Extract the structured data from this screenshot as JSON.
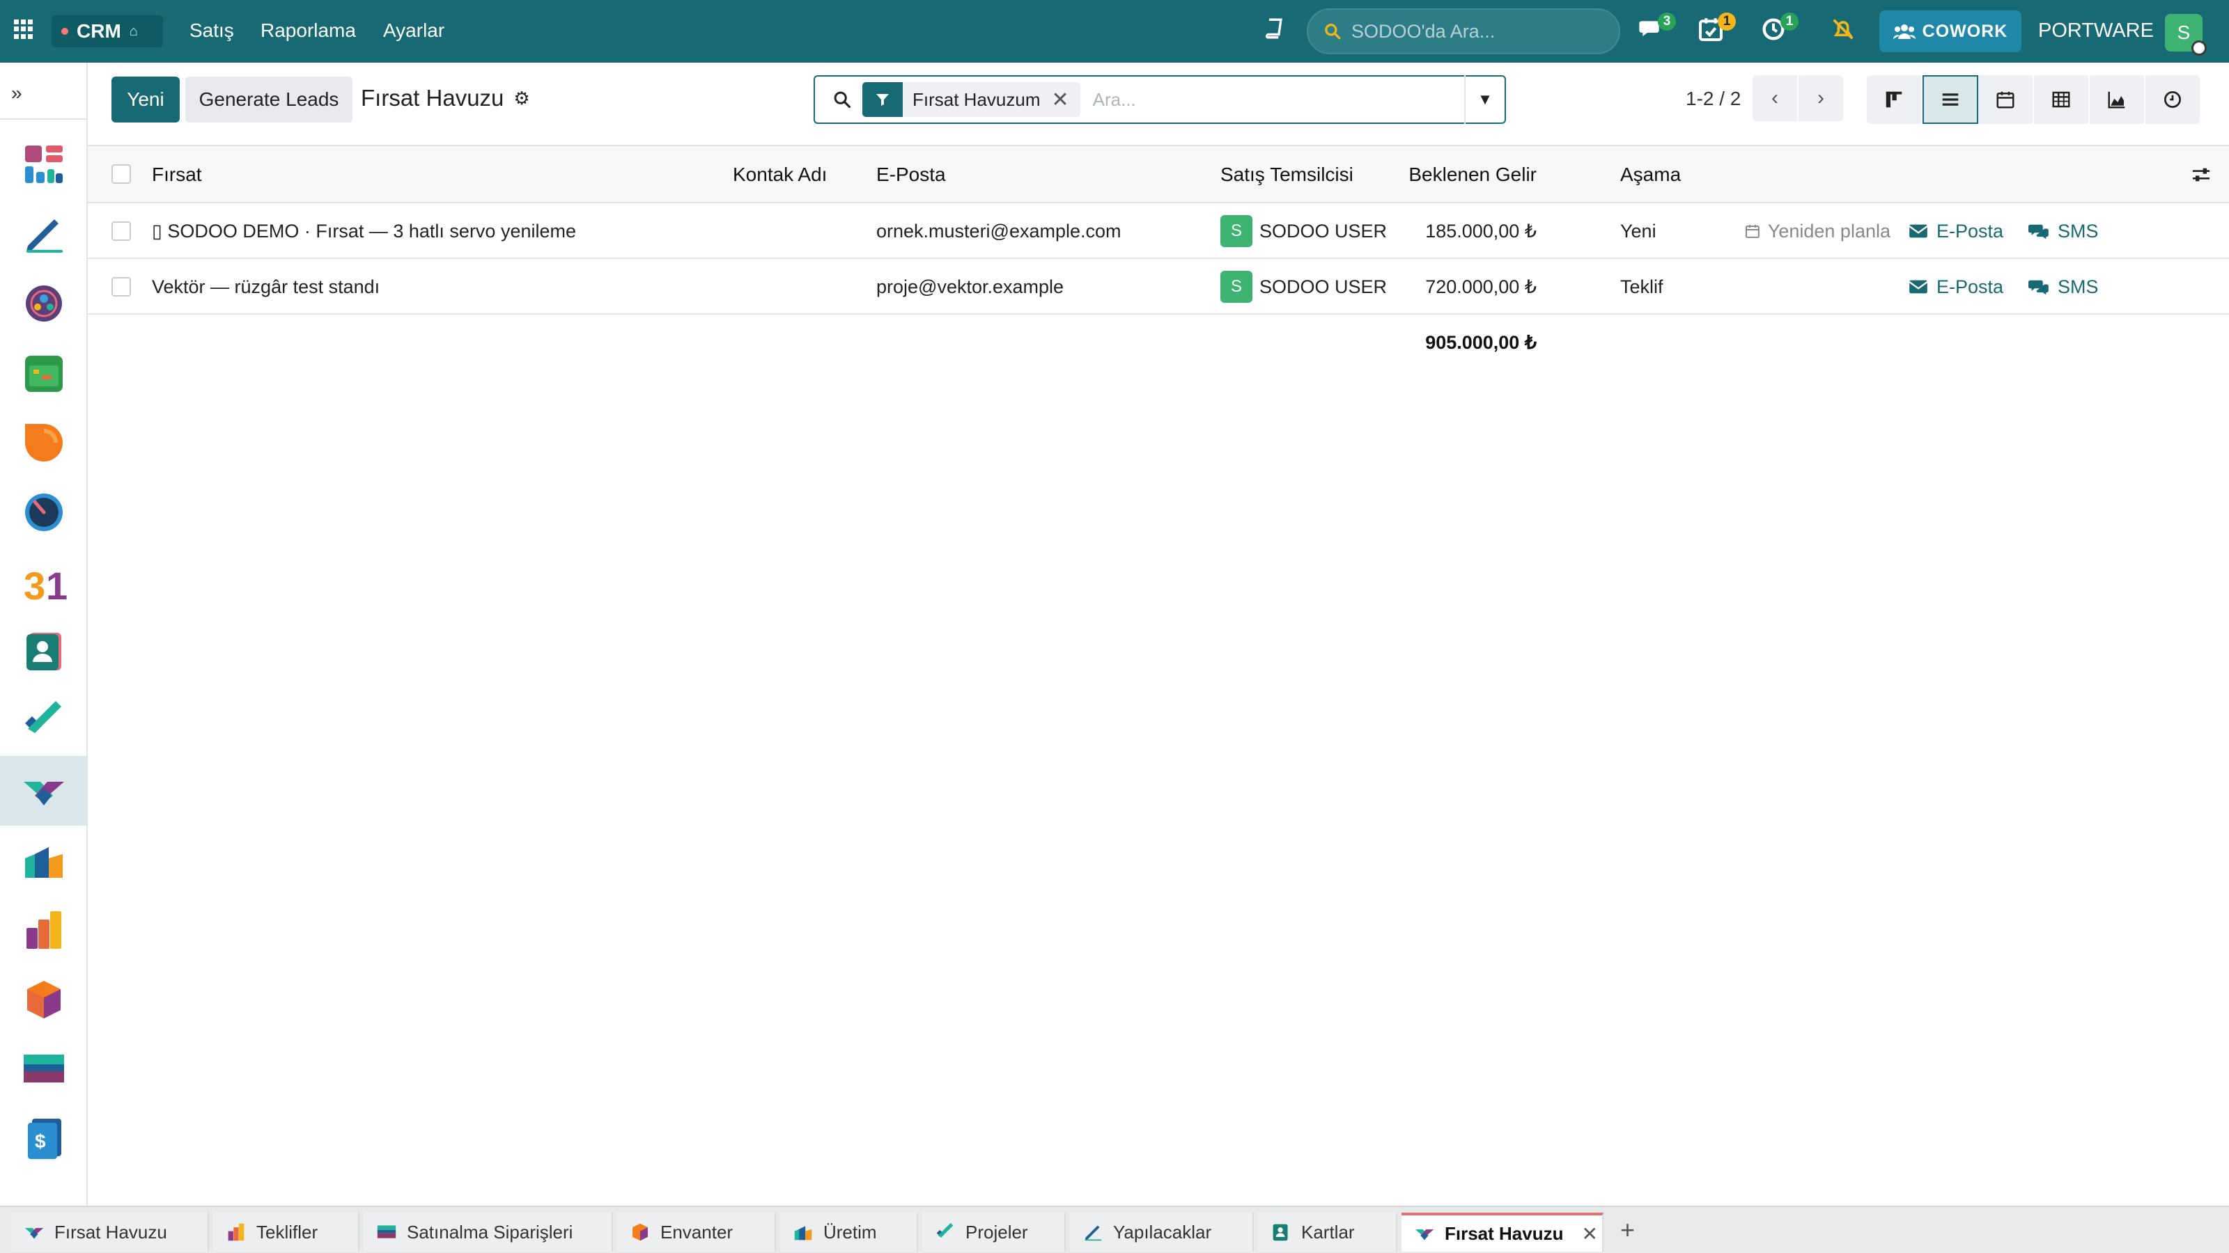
{
  "topnav": {
    "app_name": "CRM",
    "menu": [
      "Satış",
      "Raporlama",
      "Ayarlar"
    ],
    "search_placeholder": "SODOO'da Ara...",
    "badges": {
      "messages": "3",
      "activities": "1",
      "timer": "1"
    },
    "cowork_label": "COWORK",
    "company": "PORTWARE",
    "user_initial": "S"
  },
  "sidebar": {
    "apps": [
      "dashboard",
      "notes",
      "discuss",
      "planning",
      "live-chat",
      "timesheets",
      "calendar",
      "contacts",
      "projects",
      "crm",
      "manufacturing",
      "sales",
      "inventory",
      "purchase",
      "invoicing"
    ],
    "active": "crm"
  },
  "control": {
    "new_label": "Yeni",
    "generate_leads_label": "Generate Leads",
    "title": "Fırsat Havuzu",
    "facet_label": "Fırsat Havuzum",
    "search_placeholder": "Ara...",
    "pager": "1-2 / 2"
  },
  "list": {
    "columns": {
      "opportunity": "Fırsat",
      "contact": "Kontak Adı",
      "email": "E-Posta",
      "salesperson": "Satış Temsilcisi",
      "revenue": "Beklenen Gelir",
      "stage": "Aşama"
    },
    "rows": [
      {
        "opportunity": "▯ SODOO DEMO · Fırsat — 3 hatlı servo yenileme",
        "contact": "",
        "email": "ornek.musteri@example.com",
        "salesperson_initial": "S",
        "salesperson": "SODOO USER",
        "revenue": "185.000,00 ₺",
        "stage": "Yeni",
        "plan": "Yeniden planla",
        "mail": "E-Posta",
        "sms": "SMS"
      },
      {
        "opportunity": "Vektör — rüzgâr test standı",
        "contact": "",
        "email": "proje@vektor.example",
        "salesperson_initial": "S",
        "salesperson": "SODOO USER",
        "revenue": "720.000,00 ₺",
        "stage": "Teklif",
        "plan": "",
        "mail": "E-Posta",
        "sms": "SMS"
      }
    ],
    "total_revenue": "905.000,00 ₺"
  },
  "tabs": [
    "Fırsat Havuzu",
    "Teklifler",
    "Satınalma Siparişleri",
    "Envanter",
    "Üretim",
    "Projeler",
    "Yapılacaklar",
    "Kartlar",
    "Fırsat Havuzu"
  ],
  "colors": {
    "brand": "#176a73",
    "accent_green": "#3cb371",
    "tab_active_border": "#e27474"
  }
}
